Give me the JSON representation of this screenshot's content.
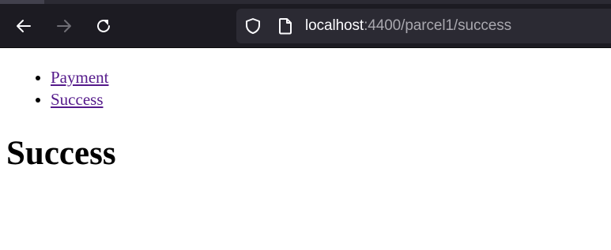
{
  "browser": {
    "url_host": "localhost",
    "url_rest": ":4400/parcel1/success",
    "icons": {
      "back": "arrow-left-icon",
      "forward": "arrow-right-icon",
      "reload": "reload-icon",
      "security": "shield-icon",
      "page": "page-icon"
    }
  },
  "page": {
    "links": [
      "Payment",
      "Success"
    ],
    "title": "Success"
  },
  "colors": {
    "toolbar_bg": "#1c1b22",
    "urlbar_bg": "#2b2a33",
    "visited_link": "#551a8b"
  }
}
